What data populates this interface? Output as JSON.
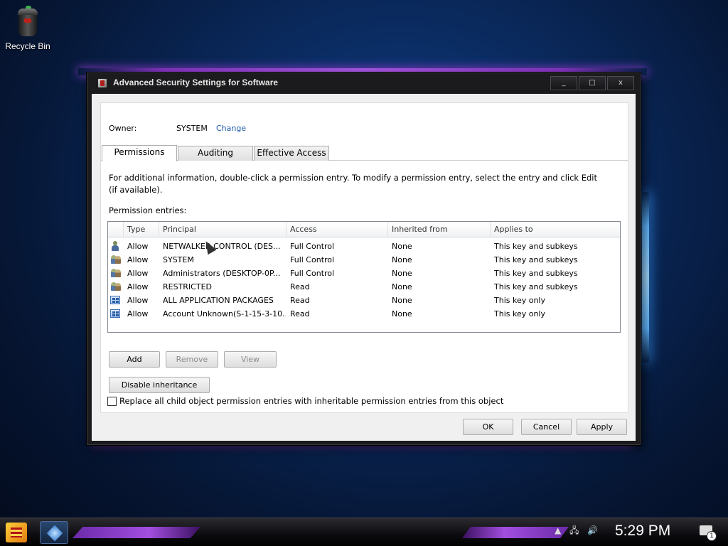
{
  "desktop": {
    "icons": [
      {
        "label": "Recycle Bin",
        "icon": "recycle-bin-icon"
      }
    ]
  },
  "window": {
    "title": "Advanced Security Settings for Software",
    "controls": {
      "minimize": "_",
      "maximize": "□",
      "close": "x"
    }
  },
  "owner": {
    "label": "Owner:",
    "value": "SYSTEM",
    "change_link": "Change"
  },
  "tabs": [
    {
      "label": "Permissions",
      "active": true
    },
    {
      "label": "Auditing",
      "active": false
    },
    {
      "label": "Effective Access",
      "active": false
    }
  ],
  "info_text": "For additional information, double-click a permission entry. To modify a permission entry, select the entry and click Edit (if available).",
  "entries_label": "Permission entries:",
  "columns": [
    "Type",
    "Principal",
    "Access",
    "Inherited from",
    "Applies to"
  ],
  "entries": [
    {
      "icon": "user-icon",
      "type": "Allow",
      "principal": "NETWALKER CONTROL (DES...",
      "access": "Full Control",
      "inherited": "None",
      "applies": "This key and subkeys"
    },
    {
      "icon": "group-icon",
      "type": "Allow",
      "principal": "SYSTEM",
      "access": "Full Control",
      "inherited": "None",
      "applies": "This key and subkeys"
    },
    {
      "icon": "group-icon",
      "type": "Allow",
      "principal": "Administrators (DESKTOP-0P...",
      "access": "Full Control",
      "inherited": "None",
      "applies": "This key and subkeys"
    },
    {
      "icon": "group-icon",
      "type": "Allow",
      "principal": "RESTRICTED",
      "access": "Read",
      "inherited": "None",
      "applies": "This key and subkeys"
    },
    {
      "icon": "package-icon",
      "type": "Allow",
      "principal": "ALL APPLICATION PACKAGES",
      "access": "Read",
      "inherited": "None",
      "applies": "This key only"
    },
    {
      "icon": "package-icon",
      "type": "Allow",
      "principal": "Account Unknown(S-1-15-3-10...",
      "access": "Read",
      "inherited": "None",
      "applies": "This key only"
    }
  ],
  "buttons": {
    "add": "Add",
    "remove": "Remove",
    "view": "View",
    "disable_inheritance": "Disable inheritance",
    "ok": "OK",
    "cancel": "Cancel",
    "apply": "Apply"
  },
  "replace_checkbox": {
    "label": "Replace all child object permission entries with inheritable permission entries from this object",
    "checked": false
  },
  "taskbar": {
    "clock": "5:29 PM",
    "notification_count": "1"
  }
}
